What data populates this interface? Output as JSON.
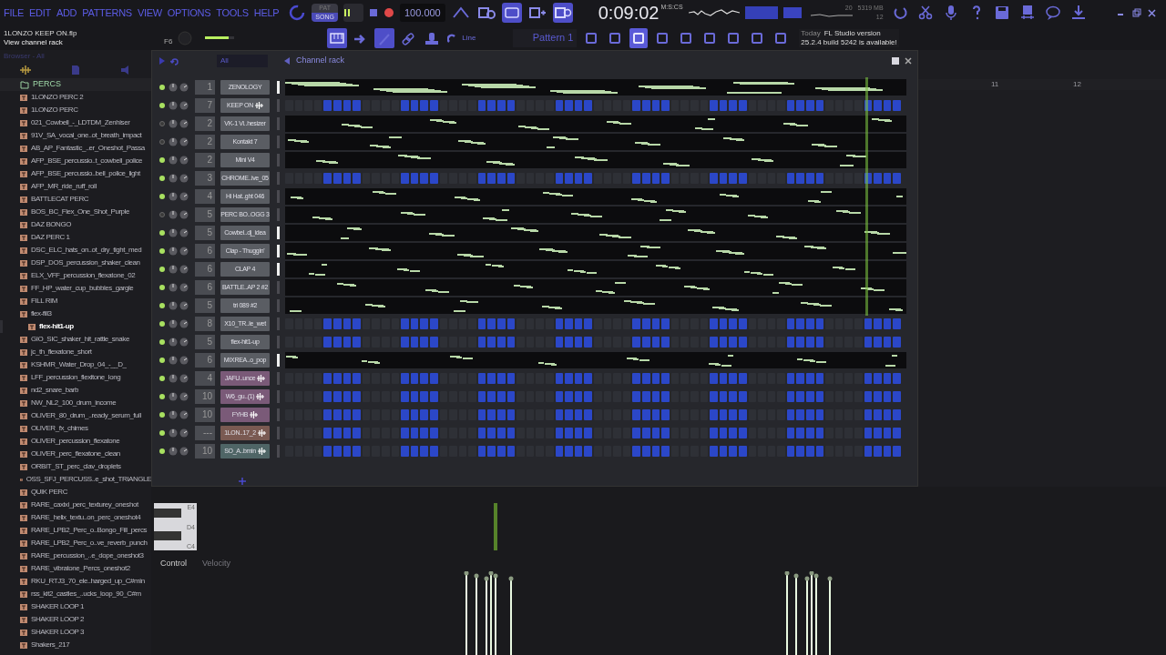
{
  "menu": [
    "FILE",
    "EDIT",
    "ADD",
    "PATTERNS",
    "VIEW",
    "OPTIONS",
    "TOOLS",
    "HELP"
  ],
  "transport": {
    "modes": [
      {
        "label": "PAT",
        "selected": false
      },
      {
        "label": "SONG",
        "selected": true
      }
    ],
    "tempo": "100.000",
    "time": "0:09:02",
    "time_unit": "M:S:CS",
    "cpu": "20",
    "memory": "5319 MB",
    "polyphony": "12"
  },
  "record_options": [
    {
      "on": false
    },
    {
      "on": false
    },
    {
      "on": true
    },
    {
      "on": false
    },
    {
      "on": true
    }
  ],
  "hint_bar": {
    "project": "1LONZO KEEP ON.flp",
    "hint": "View channel rack",
    "shortcut": "F6",
    "pitch": {
      "level": 0.8
    }
  },
  "toolbar": {
    "snap": "Line",
    "pattern": "Pattern 1",
    "view_buttons": [
      {
        "on": true
      },
      {
        "on": false
      },
      {
        "on": true
      },
      {
        "on": false
      },
      {
        "on": false
      }
    ]
  },
  "news": {
    "when": "Today",
    "title": "FL Studio version",
    "text": "25.2.4 build 5242 is available!"
  },
  "browser": {
    "header": "Browser - All",
    "folder": "PERCS",
    "items": [
      {
        "label": "1LONZO PERC 2",
        "selected": false
      },
      {
        "label": "1LONZO PERC",
        "selected": false
      },
      {
        "label": "021_Cowbell_-_LDTDM_Zenhiser",
        "selected": false
      },
      {
        "label": "91V_SA_vocal_one..ot_breath_impact",
        "selected": false
      },
      {
        "label": "AB_AP_Fantastic_..er_Oneshot_Passa",
        "selected": false
      },
      {
        "label": "AFP_BSE_percussio..t_cowbell_police",
        "selected": false
      },
      {
        "label": "AFP_BSE_percussio..bell_police_light",
        "selected": false
      },
      {
        "label": "AFP_MR_ride_ruff_roll",
        "selected": false
      },
      {
        "label": "BATTLECAT PERC",
        "selected": false
      },
      {
        "label": "BOS_BC_Flex_One_Shot_Purple",
        "selected": false
      },
      {
        "label": "DAZ BONGO",
        "selected": false
      },
      {
        "label": "DAZ PERC 1",
        "selected": false
      },
      {
        "label": "DSC_ELC_hats_on..ot_dry_tight_med",
        "selected": false
      },
      {
        "label": "DSP_DOS_percussion_shaker_clean",
        "selected": false
      },
      {
        "label": "ELX_VFF_percussion_flexatone_02",
        "selected": false
      },
      {
        "label": "FF_HP_water_cup_bubbles_gargle",
        "selected": false
      },
      {
        "label": "FILL RIM",
        "selected": false
      },
      {
        "label": "flex-fill3",
        "selected": false
      },
      {
        "label": "flex-hit1-up",
        "selected": true
      },
      {
        "label": "GIO_SIC_shaker_hit_rattle_snake",
        "selected": false
      },
      {
        "label": "jc_th_flexatone_short",
        "selected": false
      },
      {
        "label": "KSHMR_Water_Drop_04_-__D_",
        "selected": false
      },
      {
        "label": "LFF_percussion_flexitone_long",
        "selected": false
      },
      {
        "label": "nd2_snare_barb",
        "selected": false
      },
      {
        "label": "NW_NL2_100_drum_income",
        "selected": false
      },
      {
        "label": "OLIVER_80_drum_..ready_serum_full",
        "selected": false
      },
      {
        "label": "OLIVER_fx_chimes",
        "selected": false
      },
      {
        "label": "OLIVER_percussion_flexatone",
        "selected": false
      },
      {
        "label": "OLIVER_perc_flexatone_clean",
        "selected": false
      },
      {
        "label": "ORBIT_ST_perc_clav_droplets",
        "selected": false
      },
      {
        "label": "OSS_SFJ_PERCUSS..e_shot_TRIANGLE",
        "selected": false
      },
      {
        "label": "QUIK PERC",
        "selected": false
      },
      {
        "label": "RARE_caxixi_perc_texturey_oneshot",
        "selected": false
      },
      {
        "label": "RARE_helix_textu..on_perc_oneshot4",
        "selected": false
      },
      {
        "label": "RARE_LPB2_Perc_o..Bongo_Fill_percs",
        "selected": false
      },
      {
        "label": "RARE_LPB2_Perc_o..ve_reverb_punch",
        "selected": false
      },
      {
        "label": "RARE_percussion_..e_dope_oneshot3",
        "selected": false
      },
      {
        "label": "RARE_vibratone_Percs_oneshot2",
        "selected": false
      },
      {
        "label": "RKU_RTJ3_70_ele..harged_up_C#min",
        "selected": false
      },
      {
        "label": "rss_kit2_castles_..ucks_loop_90_C#m",
        "selected": false
      },
      {
        "label": "SHAKER LOOP 1",
        "selected": false
      },
      {
        "label": "SHAKER LOOP 2",
        "selected": false
      },
      {
        "label": "SHAKER LOOP 3",
        "selected": false
      },
      {
        "label": "Shakers_217",
        "selected": false
      }
    ]
  },
  "channel_rack": {
    "title": "Channel rack",
    "filter": "All",
    "channels": [
      {
        "name": "ZENOLOGY",
        "mixer": "1",
        "on": true,
        "selected": true,
        "color": "#5a5d63",
        "kind": "notes",
        "audio": false
      },
      {
        "name": "KEEP ON",
        "mixer": "7",
        "on": true,
        "selected": false,
        "color": "#5a5d63",
        "kind": "steps",
        "audio": true,
        "steps": [
          false,
          false,
          false,
          false,
          true,
          true,
          true,
          true,
          false,
          false,
          false,
          false,
          true,
          true,
          true,
          true,
          false,
          false,
          false,
          false,
          true,
          true,
          true,
          true,
          false,
          false,
          false,
          false,
          true,
          true,
          true,
          true,
          false,
          false,
          false,
          false,
          true,
          true,
          true,
          true,
          false,
          false,
          false,
          false,
          true,
          true,
          true,
          true,
          false,
          false,
          false,
          false,
          true,
          true,
          true,
          true,
          false,
          false,
          false,
          false,
          true,
          true,
          true,
          true
        ]
      },
      {
        "name": "VK-1 Vi..hesizer",
        "mixer": "2",
        "on": false,
        "selected": false,
        "color": "#5a5d63",
        "kind": "notes",
        "audio": false
      },
      {
        "name": "Kontakt 7",
        "mixer": "2",
        "on": false,
        "selected": false,
        "color": "#5a5d63",
        "kind": "notes",
        "audio": false
      },
      {
        "name": "Mini V4",
        "mixer": "2",
        "on": true,
        "selected": false,
        "color": "#5a5d63",
        "kind": "notes",
        "audio": false
      },
      {
        "name": "CHROME..ive_05",
        "mixer": "3",
        "on": true,
        "selected": false,
        "color": "#5a5d63",
        "kind": "steps",
        "audio": false,
        "steps": [
          false,
          false,
          false,
          false,
          true,
          true,
          true,
          true,
          false,
          false,
          false,
          false,
          true,
          true,
          true,
          true,
          false,
          false,
          false,
          false,
          true,
          true,
          true,
          true,
          false,
          false,
          false,
          false,
          true,
          true,
          true,
          true,
          false,
          false,
          false,
          false,
          true,
          true,
          true,
          true,
          false,
          false,
          false,
          false,
          true,
          true,
          true,
          true,
          false,
          false,
          false,
          false,
          true,
          true,
          true,
          true,
          false,
          false,
          false,
          false,
          true,
          true,
          true,
          true
        ]
      },
      {
        "name": "Hi Hat..ght 046",
        "mixer": "4",
        "on": true,
        "selected": false,
        "color": "#5a5d63",
        "kind": "notes",
        "audio": false
      },
      {
        "name": "PERC BO..OGG 3",
        "mixer": "5",
        "on": false,
        "selected": false,
        "color": "#5a5d63",
        "kind": "notes",
        "audio": false
      },
      {
        "name": "Cowbel..dj_idea",
        "mixer": "5",
        "on": true,
        "selected": true,
        "color": "#5a5d63",
        "kind": "notes",
        "audio": false
      },
      {
        "name": "Clap - Thuggin'",
        "mixer": "6",
        "on": true,
        "selected": true,
        "color": "#5a5d63",
        "kind": "notes",
        "audio": false
      },
      {
        "name": "CLAP 4",
        "mixer": "6",
        "on": true,
        "selected": true,
        "color": "#5a5d63",
        "kind": "notes",
        "audio": false
      },
      {
        "name": "BATTLE..AP 2 #2",
        "mixer": "6",
        "on": true,
        "selected": false,
        "color": "#5a5d63",
        "kind": "notes",
        "audio": false
      },
      {
        "name": "tri 089 #2",
        "mixer": "5",
        "on": true,
        "selected": false,
        "color": "#5a5d63",
        "kind": "notes",
        "audio": false
      },
      {
        "name": "X10_TR..le_wet",
        "mixer": "8",
        "on": true,
        "selected": false,
        "color": "#5a5d63",
        "kind": "steps",
        "audio": false,
        "steps": [
          false,
          false,
          false,
          false,
          true,
          true,
          true,
          true,
          false,
          false,
          false,
          false,
          true,
          true,
          true,
          true,
          false,
          false,
          false,
          false,
          true,
          true,
          true,
          true,
          false,
          false,
          false,
          false,
          true,
          true,
          true,
          true,
          false,
          false,
          false,
          false,
          true,
          true,
          true,
          true,
          false,
          false,
          false,
          false,
          true,
          true,
          true,
          true,
          false,
          false,
          false,
          false,
          true,
          true,
          true,
          true,
          false,
          false,
          false,
          false,
          true,
          true,
          true,
          true
        ]
      },
      {
        "name": "flex-hit1-up",
        "mixer": "5",
        "on": true,
        "selected": false,
        "color": "#5a5d63",
        "kind": "steps",
        "audio": false,
        "steps": [
          false,
          false,
          false,
          false,
          true,
          true,
          true,
          true,
          false,
          false,
          false,
          false,
          true,
          true,
          true,
          true,
          false,
          false,
          false,
          false,
          true,
          true,
          true,
          true,
          false,
          false,
          false,
          false,
          true,
          true,
          true,
          true,
          false,
          false,
          false,
          false,
          true,
          true,
          true,
          true,
          false,
          false,
          false,
          false,
          true,
          true,
          true,
          true,
          false,
          false,
          false,
          false,
          true,
          true,
          true,
          true,
          false,
          false,
          false,
          false,
          true,
          true,
          true,
          true
        ]
      },
      {
        "name": "MIXREA..o_pop",
        "mixer": "6",
        "on": true,
        "selected": true,
        "color": "#5a5d63",
        "kind": "notes",
        "audio": false
      },
      {
        "name": "JAFU..unce",
        "mixer": "4",
        "on": true,
        "selected": false,
        "color": "#7a5a78",
        "kind": "steps",
        "audio": true,
        "steps": [
          false,
          false,
          false,
          false,
          true,
          true,
          true,
          true,
          false,
          false,
          false,
          false,
          true,
          true,
          true,
          true,
          false,
          false,
          false,
          false,
          true,
          true,
          true,
          true,
          false,
          false,
          false,
          false,
          true,
          true,
          true,
          true,
          false,
          false,
          false,
          false,
          true,
          true,
          true,
          true,
          false,
          false,
          false,
          false,
          true,
          true,
          true,
          true,
          false,
          false,
          false,
          false,
          true,
          true,
          true,
          true,
          false,
          false,
          false,
          false,
          true,
          true,
          true,
          true
        ]
      },
      {
        "name": "W6_gu..(1)",
        "mixer": "10",
        "on": true,
        "selected": false,
        "color": "#7a5a78",
        "kind": "steps",
        "audio": true,
        "steps": [
          false,
          false,
          false,
          false,
          true,
          true,
          true,
          true,
          false,
          false,
          false,
          false,
          true,
          true,
          true,
          true,
          false,
          false,
          false,
          false,
          true,
          true,
          true,
          true,
          false,
          false,
          false,
          false,
          true,
          true,
          true,
          true,
          false,
          false,
          false,
          false,
          true,
          true,
          true,
          true,
          false,
          false,
          false,
          false,
          true,
          true,
          true,
          true,
          false,
          false,
          false,
          false,
          true,
          true,
          true,
          true,
          false,
          false,
          false,
          false,
          true,
          true,
          true,
          true
        ]
      },
      {
        "name": "FYHB",
        "mixer": "10",
        "on": true,
        "selected": false,
        "color": "#7a5a78",
        "kind": "steps",
        "audio": true,
        "steps": [
          false,
          false,
          false,
          false,
          true,
          true,
          true,
          true,
          false,
          false,
          false,
          false,
          true,
          true,
          true,
          true,
          false,
          false,
          false,
          false,
          true,
          true,
          true,
          true,
          false,
          false,
          false,
          false,
          true,
          true,
          true,
          true,
          false,
          false,
          false,
          false,
          true,
          true,
          true,
          true,
          false,
          false,
          false,
          false,
          true,
          true,
          true,
          true,
          false,
          false,
          false,
          false,
          true,
          true,
          true,
          true,
          false,
          false,
          false,
          false,
          true,
          true,
          true,
          true
        ]
      },
      {
        "name": "1LON..17_2",
        "mixer": "---",
        "on": true,
        "selected": false,
        "color": "#7a5a52",
        "kind": "steps",
        "audio": true,
        "steps": [
          false,
          false,
          false,
          false,
          true,
          true,
          true,
          true,
          false,
          false,
          false,
          false,
          true,
          true,
          true,
          true,
          false,
          false,
          false,
          false,
          true,
          true,
          true,
          true,
          false,
          false,
          false,
          false,
          true,
          true,
          true,
          true,
          false,
          false,
          false,
          false,
          true,
          true,
          true,
          true,
          false,
          false,
          false,
          false,
          true,
          true,
          true,
          true,
          false,
          false,
          false,
          false,
          true,
          true,
          true,
          true,
          false,
          false,
          false,
          false,
          true,
          true,
          true,
          true
        ]
      },
      {
        "name": "SO_A..bmin",
        "mixer": "10",
        "on": true,
        "selected": false,
        "color": "#4f6566",
        "kind": "steps",
        "audio": true,
        "steps": [
          false,
          false,
          false,
          false,
          true,
          true,
          true,
          true,
          false,
          false,
          false,
          false,
          true,
          true,
          true,
          true,
          false,
          false,
          false,
          false,
          true,
          true,
          true,
          true,
          false,
          false,
          false,
          false,
          true,
          true,
          true,
          true,
          false,
          false,
          false,
          false,
          true,
          true,
          true,
          true,
          false,
          false,
          false,
          false,
          true,
          true,
          true,
          true,
          false,
          false,
          false,
          false,
          true,
          true,
          true,
          true,
          false,
          false,
          false,
          false,
          true,
          true,
          true,
          true
        ]
      }
    ]
  },
  "playlist": {
    "bars": [
      "11",
      "12"
    ]
  },
  "piano_roll": {
    "keys": [
      "E4",
      "D4",
      "C4"
    ],
    "control": "Control",
    "parameter": "Velocity"
  }
}
